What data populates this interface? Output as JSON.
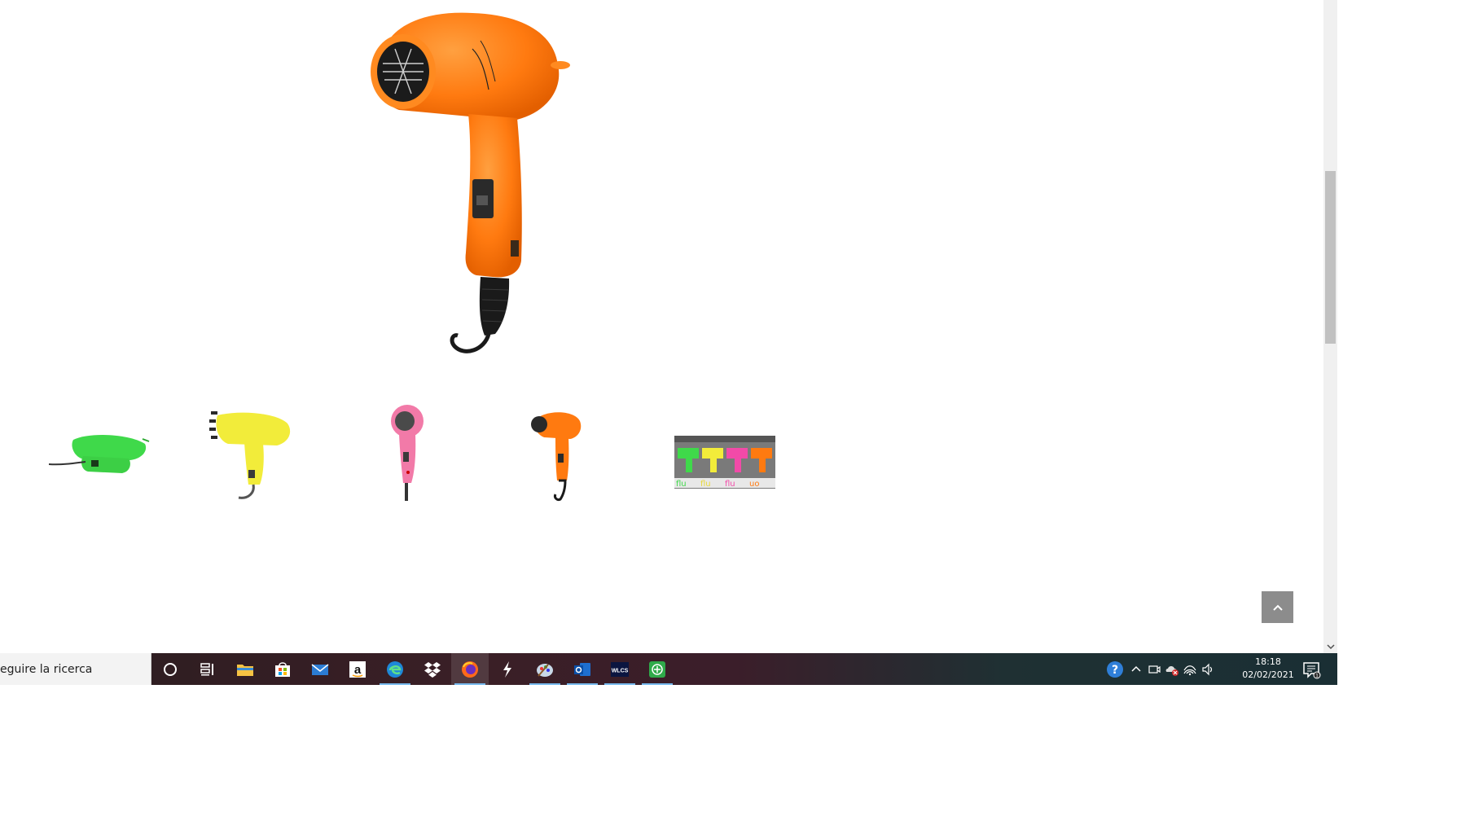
{
  "product": {
    "main_image": "orange-hair-dryer",
    "thumbnails": [
      {
        "name": "green-folded-hair-dryer",
        "color": "#3fd94a"
      },
      {
        "name": "yellow-hair-dryer",
        "color": "#f2ec3a"
      },
      {
        "name": "pink-hair-dryer",
        "color": "#f27aa8"
      },
      {
        "name": "orange-hair-dryer",
        "color": "#ff7a10"
      },
      {
        "name": "fluo-pack",
        "color": "#888888"
      }
    ]
  },
  "taskbar": {
    "search_placeholder": "eguire la ricerca",
    "apps": [
      "cortana-icon",
      "task-view-icon",
      "file-explorer-icon",
      "store-icon",
      "mail-icon",
      "amazon-icon",
      "edge-icon",
      "dropbox-icon",
      "firefox-icon",
      "app-bolt-icon",
      "paint-icon",
      "outlook-icon",
      "wlcs-icon",
      "app-green-icon"
    ],
    "wlcs_label": "WLCS",
    "amazon_label": "a"
  },
  "clock": {
    "time": "18:18",
    "date": "02/02/2021"
  },
  "colors": {
    "accent": "#76b9ed",
    "back_to_top": "#8c8c8c"
  }
}
